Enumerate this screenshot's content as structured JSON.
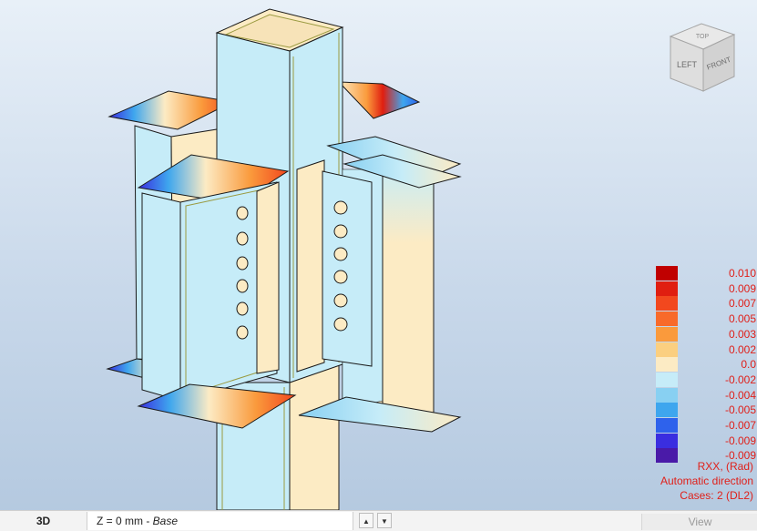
{
  "viewcube": {
    "face_left": "LEFT",
    "face_front": "FRONT",
    "face_top": "TOP"
  },
  "legend": {
    "entries": [
      {
        "label": "0.010",
        "color": "#c00000"
      },
      {
        "label": "0.009",
        "color": "#e01e10"
      },
      {
        "label": "0.007",
        "color": "#f2481e"
      },
      {
        "label": "0.005",
        "color": "#f86a2a"
      },
      {
        "label": "0.003",
        "color": "#fa9a3c"
      },
      {
        "label": "0.002",
        "color": "#fbcf80"
      },
      {
        "label": "0.0",
        "color": "#fcebc4"
      },
      {
        "label": "-0.002",
        "color": "#c6ecf8"
      },
      {
        "label": "-0.004",
        "color": "#88d0f2"
      },
      {
        "label": "-0.005",
        "color": "#3ea6ee"
      },
      {
        "label": "-0.007",
        "color": "#2e62ec"
      },
      {
        "label": "-0.009",
        "color": "#3a2ee0"
      },
      {
        "label": "-0.009",
        "color": "#4a1aa8"
      }
    ]
  },
  "info": {
    "result": "RXX, (Rad)",
    "direction": "Automatic direction",
    "cases": "Cases: 2 (DL2)"
  },
  "statusbar": {
    "view_mode": "3D",
    "level_prefix": "Z = 0 mm - ",
    "level_name": "Base",
    "view_button": "View"
  }
}
